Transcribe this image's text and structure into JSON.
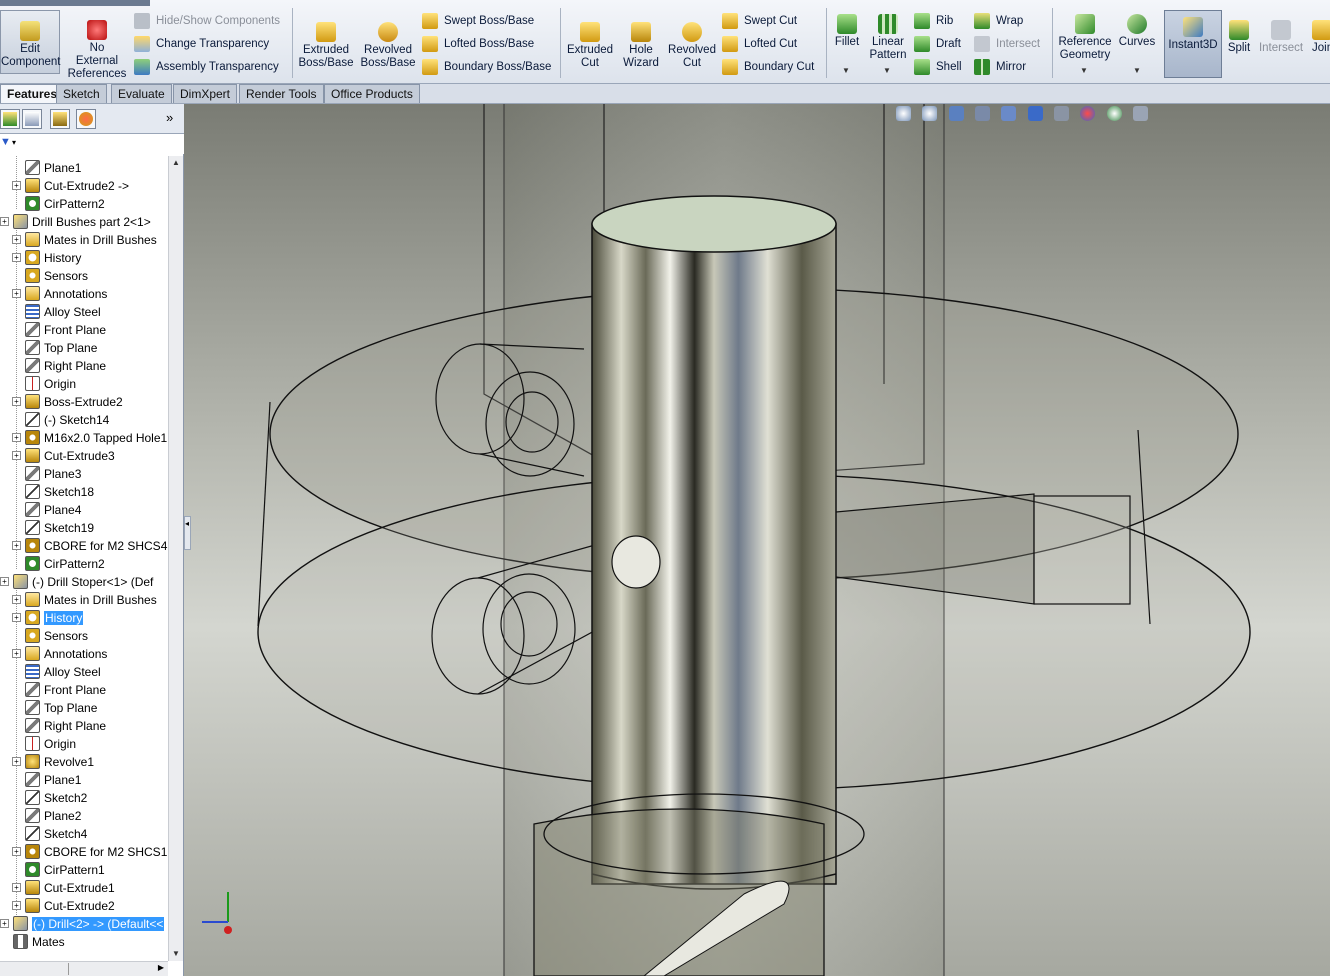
{
  "ribbon": {
    "edit_component": "Edit\nComponent",
    "no_external_refs": "No\nExternal\nReferences",
    "hide_show": "Hide/Show Components",
    "change_transparency": "Change Transparency",
    "assembly_transparency": "Assembly Transparency",
    "extruded_boss": "Extruded\nBoss/Base",
    "revolved_boss": "Revolved\nBoss/Base",
    "swept_boss": "Swept Boss/Base",
    "lofted_boss": "Lofted Boss/Base",
    "boundary_boss": "Boundary Boss/Base",
    "extruded_cut": "Extruded\nCut",
    "hole_wizard": "Hole\nWizard",
    "revolved_cut": "Revolved\nCut",
    "swept_cut": "Swept Cut",
    "lofted_cut": "Lofted Cut",
    "boundary_cut": "Boundary Cut",
    "fillet": "Fillet",
    "linear_pattern": "Linear\nPattern",
    "rib": "Rib",
    "draft": "Draft",
    "shell": "Shell",
    "wrap": "Wrap",
    "intersect_small": "Intersect",
    "mirror": "Mirror",
    "reference_geometry": "Reference\nGeometry",
    "curves": "Curves",
    "instant3d": "Instant3D",
    "split": "Split",
    "intersect": "Intersect",
    "join": "Join"
  },
  "tabs": [
    "Features",
    "Sketch",
    "Evaluate",
    "DimXpert",
    "Render Tools",
    "Office Products"
  ],
  "tree": [
    {
      "label": "Plane1",
      "icon": "plane-icon",
      "indent": 1,
      "exp": false
    },
    {
      "label": "Cut-Extrude2 ->",
      "icon": "cut-extrude-icon",
      "indent": 1,
      "exp": true
    },
    {
      "label": "CirPattern2",
      "icon": "circular-pattern-icon",
      "indent": 1,
      "exp": false
    },
    {
      "label": "Drill Bushes part 2<1>",
      "icon": "part-icon",
      "indent": 0,
      "exp": true
    },
    {
      "label": "Mates in Drill Bushes",
      "icon": "mates-folder-icon",
      "indent": 1,
      "exp": true
    },
    {
      "label": "History",
      "icon": "history-icon",
      "indent": 1,
      "exp": true
    },
    {
      "label": "Sensors",
      "icon": "sensors-icon",
      "indent": 1,
      "exp": false
    },
    {
      "label": "Annotations",
      "icon": "annotations-icon",
      "indent": 1,
      "exp": true
    },
    {
      "label": "Alloy Steel",
      "icon": "material-icon",
      "indent": 1,
      "exp": false
    },
    {
      "label": "Front Plane",
      "icon": "plane-icon",
      "indent": 1,
      "exp": false
    },
    {
      "label": "Top Plane",
      "icon": "plane-icon",
      "indent": 1,
      "exp": false
    },
    {
      "label": "Right Plane",
      "icon": "plane-icon",
      "indent": 1,
      "exp": false
    },
    {
      "label": "Origin",
      "icon": "origin-icon",
      "indent": 1,
      "exp": false
    },
    {
      "label": "Boss-Extrude2",
      "icon": "boss-extrude-icon",
      "indent": 1,
      "exp": true
    },
    {
      "label": "(-) Sketch14",
      "icon": "sketch-icon",
      "indent": 1,
      "exp": false
    },
    {
      "label": "M16x2.0 Tapped Hole1",
      "icon": "hole-icon",
      "indent": 1,
      "exp": true
    },
    {
      "label": "Cut-Extrude3",
      "icon": "cut-extrude-icon",
      "indent": 1,
      "exp": true
    },
    {
      "label": "Plane3",
      "icon": "plane-icon",
      "indent": 1,
      "exp": false
    },
    {
      "label": "Sketch18",
      "icon": "sketch-icon",
      "indent": 1,
      "exp": false
    },
    {
      "label": "Plane4",
      "icon": "plane-icon",
      "indent": 1,
      "exp": false
    },
    {
      "label": "Sketch19",
      "icon": "sketch-icon",
      "indent": 1,
      "exp": false
    },
    {
      "label": "CBORE for M2 SHCS4",
      "icon": "hole-icon",
      "indent": 1,
      "exp": true
    },
    {
      "label": "CirPattern2",
      "icon": "circular-pattern-icon",
      "indent": 1,
      "exp": false
    },
    {
      "label": "(-) Drill Stoper<1> (Def",
      "icon": "part-icon",
      "indent": 0,
      "exp": true
    },
    {
      "label": "Mates in Drill Bushes",
      "icon": "mates-folder-icon",
      "indent": 1,
      "exp": true
    },
    {
      "label": "History",
      "icon": "history-icon",
      "indent": 1,
      "exp": true,
      "selected": true
    },
    {
      "label": "Sensors",
      "icon": "sensors-icon",
      "indent": 1,
      "exp": false
    },
    {
      "label": "Annotations",
      "icon": "annotations-icon",
      "indent": 1,
      "exp": true
    },
    {
      "label": "Alloy Steel",
      "icon": "material-icon",
      "indent": 1,
      "exp": false
    },
    {
      "label": "Front Plane",
      "icon": "plane-icon",
      "indent": 1,
      "exp": false
    },
    {
      "label": "Top Plane",
      "icon": "plane-icon",
      "indent": 1,
      "exp": false
    },
    {
      "label": "Right Plane",
      "icon": "plane-icon",
      "indent": 1,
      "exp": false
    },
    {
      "label": "Origin",
      "icon": "origin-icon",
      "indent": 1,
      "exp": false
    },
    {
      "label": "Revolve1",
      "icon": "revolve-icon",
      "indent": 1,
      "exp": true
    },
    {
      "label": "Plane1",
      "icon": "plane-icon",
      "indent": 1,
      "exp": false
    },
    {
      "label": "Sketch2",
      "icon": "sketch-icon",
      "indent": 1,
      "exp": false
    },
    {
      "label": "Plane2",
      "icon": "plane-icon",
      "indent": 1,
      "exp": false
    },
    {
      "label": "Sketch4",
      "icon": "sketch-icon",
      "indent": 1,
      "exp": false
    },
    {
      "label": "CBORE for M2 SHCS1",
      "icon": "hole-icon",
      "indent": 1,
      "exp": true
    },
    {
      "label": "CirPattern1",
      "icon": "circular-pattern-icon",
      "indent": 1,
      "exp": false
    },
    {
      "label": "Cut-Extrude1",
      "icon": "cut-extrude-icon",
      "indent": 1,
      "exp": true
    },
    {
      "label": "Cut-Extrude2",
      "icon": "cut-extrude-icon",
      "indent": 1,
      "exp": true
    },
    {
      "label": "(-) Drill<2> -> (Default<<",
      "icon": "part-icon",
      "indent": 0,
      "exp": true,
      "selected": true
    },
    {
      "label": "Mates",
      "icon": "mates-icon",
      "indent": 0,
      "exp": false
    }
  ],
  "colors": {
    "selection": "#3399ff",
    "viewport_bg": "#b8bab2",
    "ribbon_bg": "#dde3ec"
  }
}
